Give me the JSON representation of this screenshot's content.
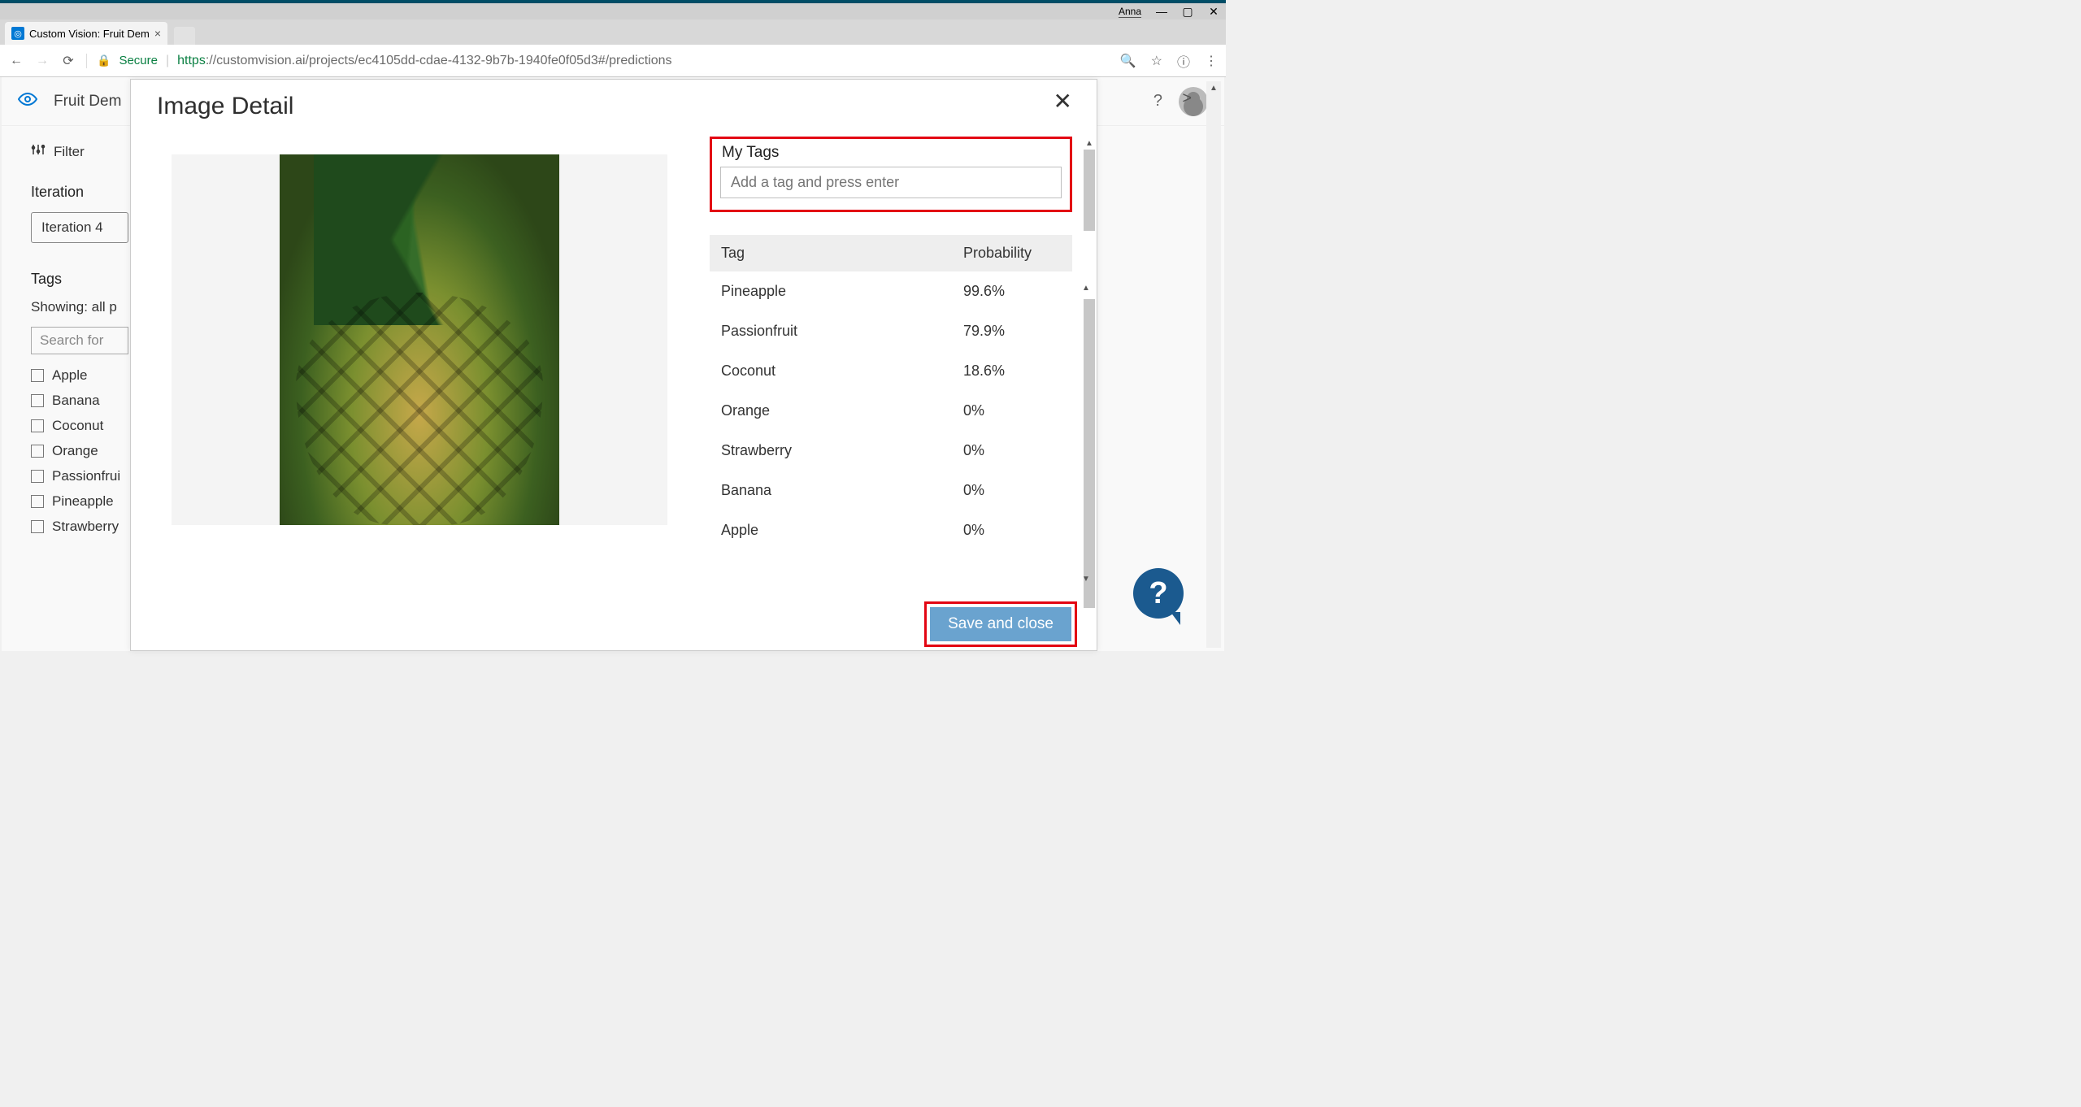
{
  "os": {
    "user": "Anna"
  },
  "browser": {
    "tab_title": "Custom Vision: Fruit Dem",
    "secure_label": "Secure",
    "url_scheme": "https",
    "url_rest": "://customvision.ai/projects/ec4105dd-cdae-4132-9b7b-1940fe0f05d3#/predictions"
  },
  "app": {
    "project_name": "Fruit Dem",
    "filter_label": "Filter",
    "iteration_label": "Iteration",
    "iteration_value": "Iteration 4",
    "tags_label": "Tags",
    "showing_label": "Showing: all p",
    "tag_search_placeholder": "Search for",
    "arrow_symbol": ">",
    "tags": [
      {
        "label": "Apple"
      },
      {
        "label": "Banana"
      },
      {
        "label": "Coconut"
      },
      {
        "label": "Orange"
      },
      {
        "label": "Passionfrui"
      },
      {
        "label": "Pineapple"
      },
      {
        "label": "Strawberry"
      }
    ]
  },
  "modal": {
    "title": "Image Detail",
    "close_symbol": "✕",
    "mytags_label": "My Tags",
    "mytags_placeholder": "Add a tag and press enter",
    "col_tag": "Tag",
    "col_prob": "Probability",
    "save_label": "Save and close",
    "predictions": [
      {
        "tag": "Pineapple",
        "prob": "99.6%"
      },
      {
        "tag": "Passionfruit",
        "prob": "79.9%"
      },
      {
        "tag": "Coconut",
        "prob": "18.6%"
      },
      {
        "tag": "Orange",
        "prob": "0%"
      },
      {
        "tag": "Strawberry",
        "prob": "0%"
      },
      {
        "tag": "Banana",
        "prob": "0%"
      },
      {
        "tag": "Apple",
        "prob": "0%"
      }
    ]
  },
  "help": "?"
}
